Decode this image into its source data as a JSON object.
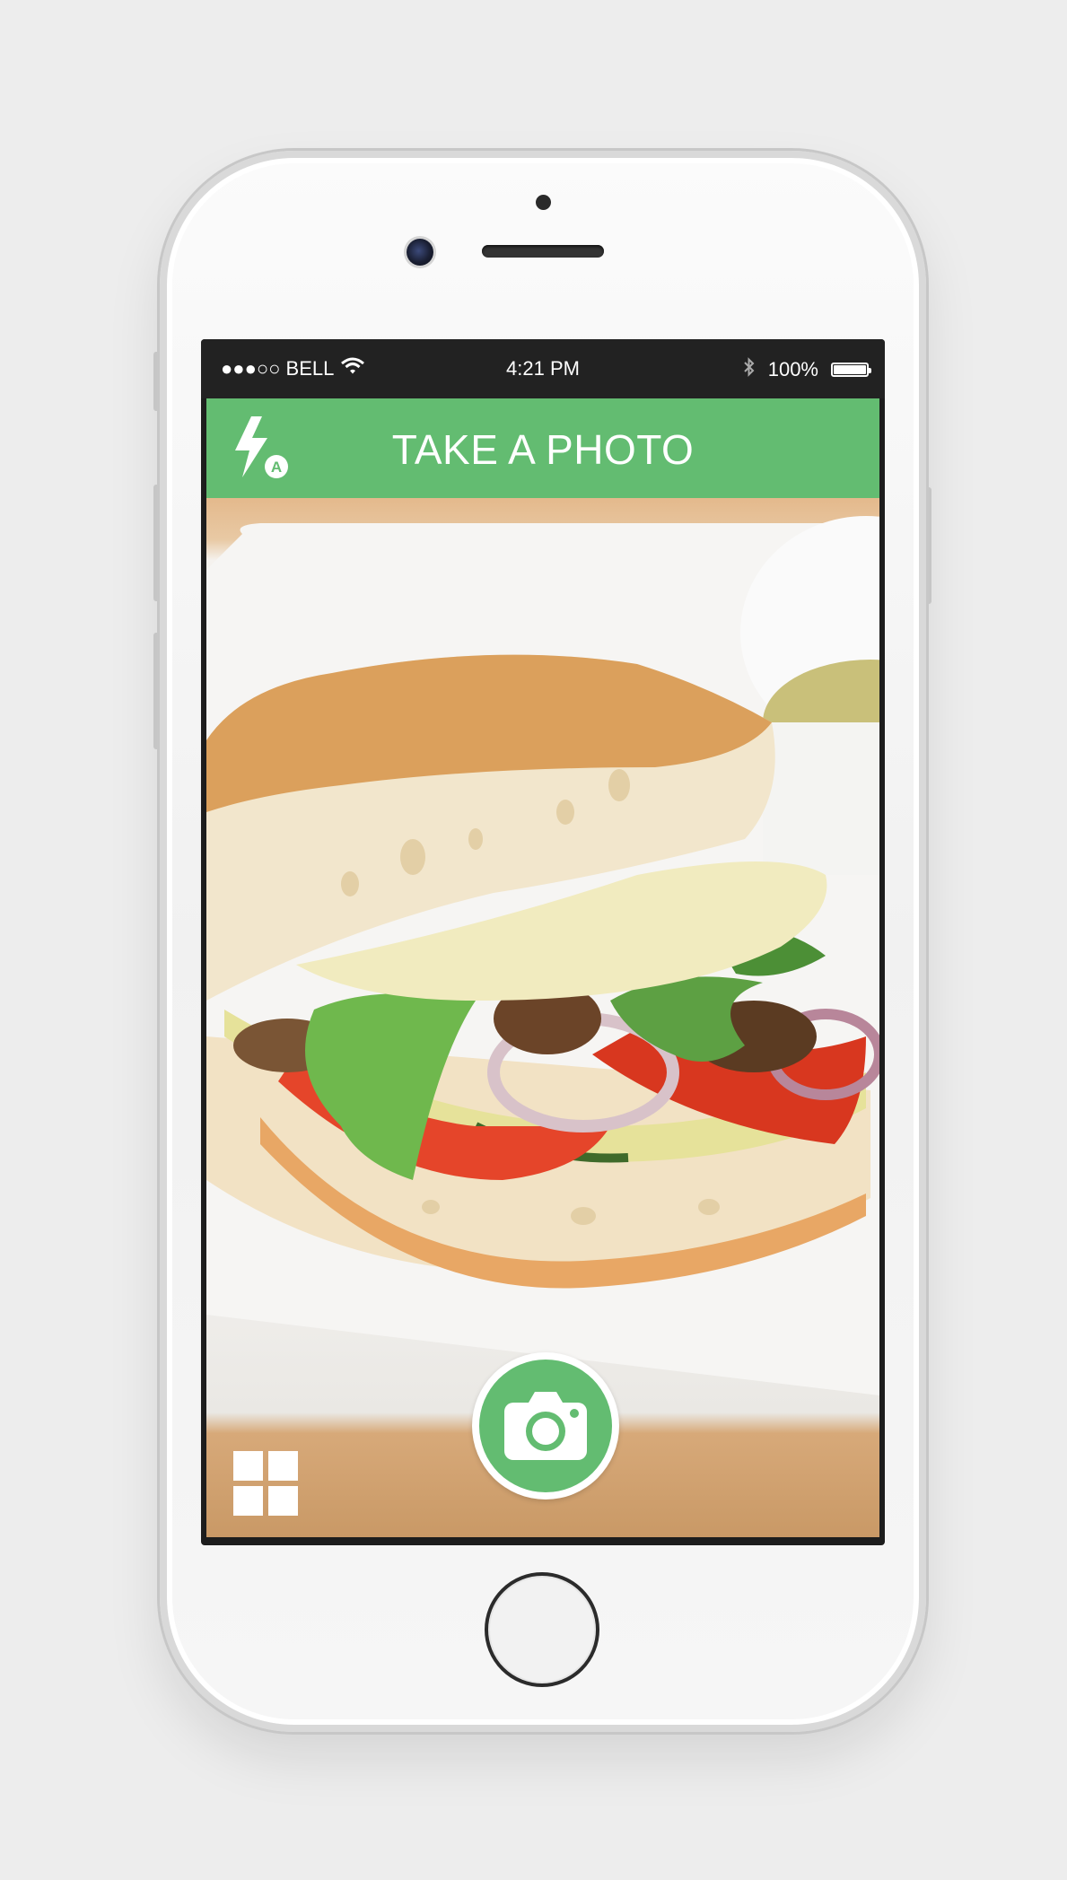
{
  "status_bar": {
    "carrier": "●●●○○ BELL",
    "time": "4:21 PM",
    "battery": "100%",
    "battery_level": 1.0
  },
  "app_bar": {
    "title": "TAKE A PHOTO",
    "flash_mode_badge": "A"
  },
  "icons": {
    "flash": "flash-auto-icon",
    "shutter": "camera-icon",
    "gallery": "grid-icon",
    "wifi": "wifi-icon",
    "bluetooth": "bluetooth-icon",
    "battery": "battery-icon"
  },
  "colors": {
    "accent": "#63bc71",
    "status_bar": "#222222"
  }
}
